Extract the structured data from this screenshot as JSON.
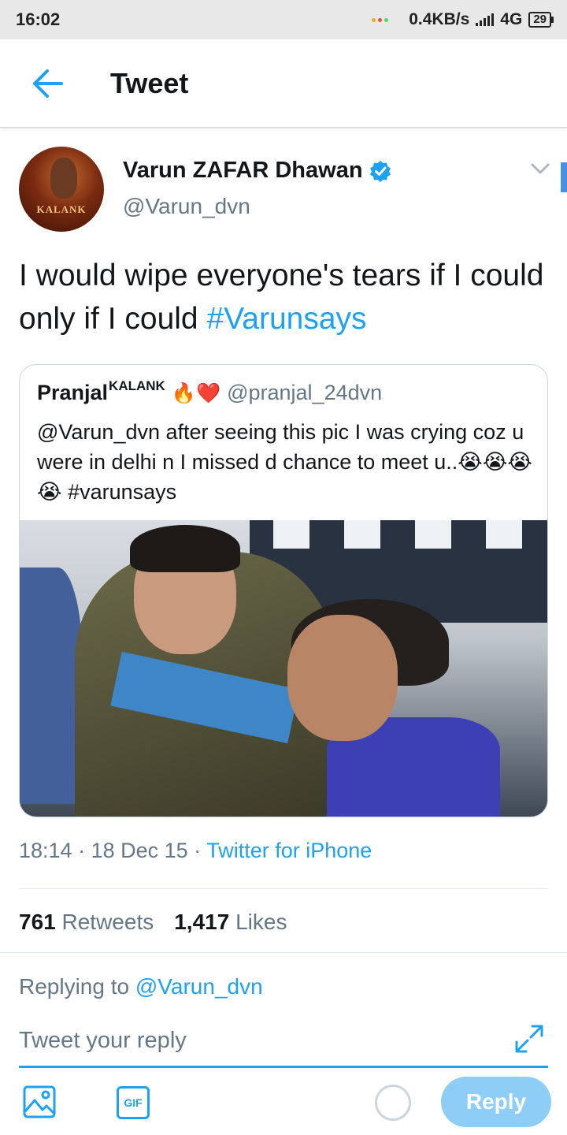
{
  "status_bar": {
    "time": "16:02",
    "network_speed": "0.4KB/s",
    "network_type": "4G",
    "battery": "29"
  },
  "header": {
    "title": "Tweet",
    "back_icon": "arrow-left-icon"
  },
  "tweet": {
    "author_name": "Varun ZAFAR Dhawan",
    "author_handle": "@Varun_dvn",
    "avatar_text": "KALANK",
    "verified_icon": "verified-badge-icon",
    "text_plain": "I would wipe everyone's tears if I could only if I could ",
    "text_hashtag": "#Varunsays",
    "quoted": {
      "author_name": "Pranjal",
      "author_name_sup": "KALANK",
      "author_emoji": "🔥❤️",
      "author_handle": "@pranjal_24dvn",
      "text_plain": "@Varun_dvn after seeing this pic I was crying coz u were in delhi n I missed d chance to meet u..😭😭😭😭 ",
      "text_hashtag": "#varunsays"
    },
    "time": "18:14",
    "date": "18 Dec 15",
    "source": "Twitter for iPhone",
    "retweets_count": "761",
    "retweets_label": "Retweets",
    "likes_count": "1,417",
    "likes_label": "Likes"
  },
  "reply": {
    "replying_prefix": "Replying to",
    "replying_mention": "@Varun_dvn",
    "placeholder": "Tweet your reply",
    "gif_label": "GIF",
    "button_label": "Reply"
  },
  "colors": {
    "accent": "#1da1f2",
    "muted": "#657786",
    "reply_button_disabled": "#8ecdf6"
  }
}
